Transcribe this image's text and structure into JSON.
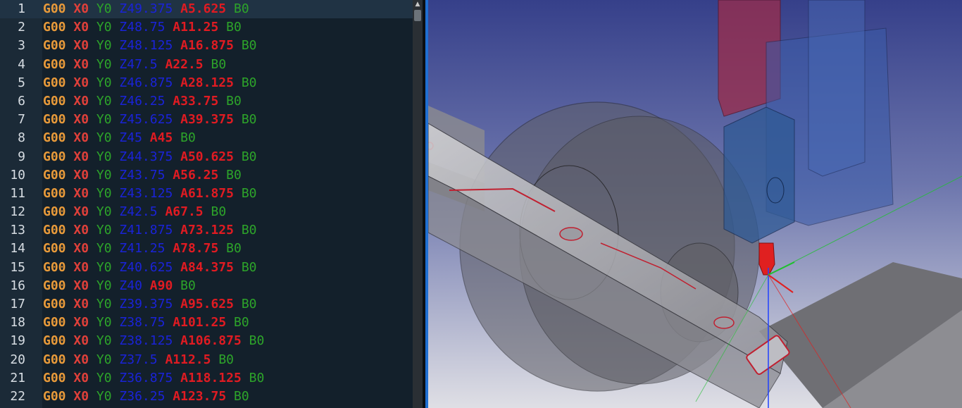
{
  "editor": {
    "active_line": 1,
    "lines": [
      {
        "n": "1",
        "g": "G00",
        "x": "X0",
        "y": "Y0",
        "z": "Z49.375",
        "a": "A5.625",
        "b": "B0"
      },
      {
        "n": "2",
        "g": "G00",
        "x": "X0",
        "y": "Y0",
        "z": "Z48.75",
        "a": "A11.25",
        "b": "B0"
      },
      {
        "n": "3",
        "g": "G00",
        "x": "X0",
        "y": "Y0",
        "z": "Z48.125",
        "a": "A16.875",
        "b": "B0"
      },
      {
        "n": "4",
        "g": "G00",
        "x": "X0",
        "y": "Y0",
        "z": "Z47.5",
        "a": "A22.5",
        "b": "B0"
      },
      {
        "n": "5",
        "g": "G00",
        "x": "X0",
        "y": "Y0",
        "z": "Z46.875",
        "a": "A28.125",
        "b": "B0"
      },
      {
        "n": "6",
        "g": "G00",
        "x": "X0",
        "y": "Y0",
        "z": "Z46.25",
        "a": "A33.75",
        "b": "B0"
      },
      {
        "n": "7",
        "g": "G00",
        "x": "X0",
        "y": "Y0",
        "z": "Z45.625",
        "a": "A39.375",
        "b": "B0"
      },
      {
        "n": "8",
        "g": "G00",
        "x": "X0",
        "y": "Y0",
        "z": "Z45",
        "a": "A45",
        "b": "B0"
      },
      {
        "n": "9",
        "g": "G00",
        "x": "X0",
        "y": "Y0",
        "z": "Z44.375",
        "a": "A50.625",
        "b": "B0"
      },
      {
        "n": "10",
        "g": "G00",
        "x": "X0",
        "y": "Y0",
        "z": "Z43.75",
        "a": "A56.25",
        "b": "B0"
      },
      {
        "n": "11",
        "g": "G00",
        "x": "X0",
        "y": "Y0",
        "z": "Z43.125",
        "a": "A61.875",
        "b": "B0"
      },
      {
        "n": "12",
        "g": "G00",
        "x": "X0",
        "y": "Y0",
        "z": "Z42.5",
        "a": "A67.5",
        "b": "B0"
      },
      {
        "n": "13",
        "g": "G00",
        "x": "X0",
        "y": "Y0",
        "z": "Z41.875",
        "a": "A73.125",
        "b": "B0"
      },
      {
        "n": "14",
        "g": "G00",
        "x": "X0",
        "y": "Y0",
        "z": "Z41.25",
        "a": "A78.75",
        "b": "B0"
      },
      {
        "n": "15",
        "g": "G00",
        "x": "X0",
        "y": "Y0",
        "z": "Z40.625",
        "a": "A84.375",
        "b": "B0"
      },
      {
        "n": "16",
        "g": "G00",
        "x": "X0",
        "y": "Y0",
        "z": "Z40",
        "a": "A90",
        "b": "B0"
      },
      {
        "n": "17",
        "g": "G00",
        "x": "X0",
        "y": "Y0",
        "z": "Z39.375",
        "a": "A95.625",
        "b": "B0"
      },
      {
        "n": "18",
        "g": "G00",
        "x": "X0",
        "y": "Y0",
        "z": "Z38.75",
        "a": "A101.25",
        "b": "B0"
      },
      {
        "n": "19",
        "g": "G00",
        "x": "X0",
        "y": "Y0",
        "z": "Z38.125",
        "a": "A106.875",
        "b": "B0"
      },
      {
        "n": "20",
        "g": "G00",
        "x": "X0",
        "y": "Y0",
        "z": "Z37.5",
        "a": "A112.5",
        "b": "B0"
      },
      {
        "n": "21",
        "g": "G00",
        "x": "X0",
        "y": "Y0",
        "z": "Z36.875",
        "a": "A118.125",
        "b": "B0"
      },
      {
        "n": "22",
        "g": "G00",
        "x": "X0",
        "y": "Y0",
        "z": "Z36.25",
        "a": "A123.75",
        "b": "B0"
      }
    ]
  },
  "colors": {
    "g_word": "#e89a3a",
    "x_word": "#e0403a",
    "y_word": "#2da42a",
    "z_word": "#1a23d8",
    "a_word": "#e01b22",
    "b_word": "#2da42a",
    "viewport_top": "#3f4a8c",
    "viewport_bottom": "#d8d8de",
    "accent": "#1f6fd1"
  },
  "viewport": {
    "view": "3D machine simulation",
    "icons": [
      "spindle-icon",
      "axis-triad-icon"
    ]
  }
}
